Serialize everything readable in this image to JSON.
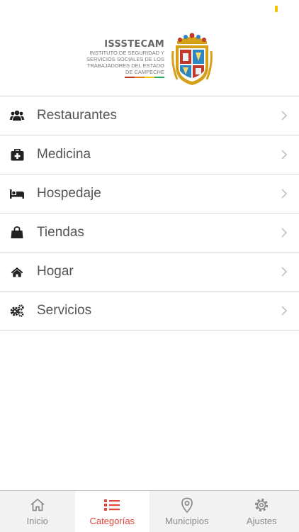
{
  "header": {
    "logo_title": "ISSSTECAM",
    "logo_line1": "Instituto de Seguridad y",
    "logo_line2": "Servicios Sociales de los",
    "logo_line3": "Trabajadores del Estado",
    "logo_line4": "de Campeche"
  },
  "categories": [
    {
      "label": "Restaurantes",
      "icon": "users-icon"
    },
    {
      "label": "Medicina",
      "icon": "medkit-icon"
    },
    {
      "label": "Hospedaje",
      "icon": "bed-icon"
    },
    {
      "label": "Tiendas",
      "icon": "shopping-bag-icon"
    },
    {
      "label": "Hogar",
      "icon": "home-icon"
    },
    {
      "label": "Servicios",
      "icon": "cogs-icon"
    }
  ],
  "tabs": [
    {
      "label": "Inicio",
      "icon": "home-outline-icon",
      "active": false
    },
    {
      "label": "Categorías",
      "icon": "list-icon",
      "active": true
    },
    {
      "label": "Municipios",
      "icon": "map-pin-icon",
      "active": false
    },
    {
      "label": "Ajustes",
      "icon": "gear-icon",
      "active": false
    }
  ],
  "colors": {
    "accent": "#e0463a",
    "tab_inactive": "#8a8a8a",
    "divider": "#d7d7d7",
    "battery": "#f5c400"
  }
}
